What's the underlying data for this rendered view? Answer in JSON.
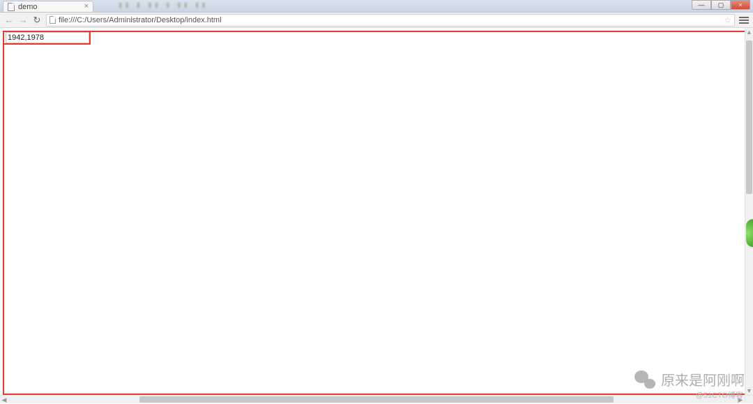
{
  "tab": {
    "title": "demo",
    "close_glyph": "×"
  },
  "toolbar": {
    "back_glyph": "←",
    "forward_glyph": "→",
    "reload_glyph": "↻",
    "url": "file:///C:/Users/Administrator/Desktop/index.html",
    "star_glyph": "☆",
    "menu_label": "≡"
  },
  "window_controls": {
    "min": "—",
    "max": "▢",
    "close": "×"
  },
  "page": {
    "input_value": "1942,1978"
  },
  "scrollbar": {
    "up": "▲",
    "down": "▼",
    "left": "◀",
    "right": "▶"
  },
  "watermark": {
    "wechat_text": "原来是阿刚啊",
    "cto_text": "@51CTO博客"
  }
}
